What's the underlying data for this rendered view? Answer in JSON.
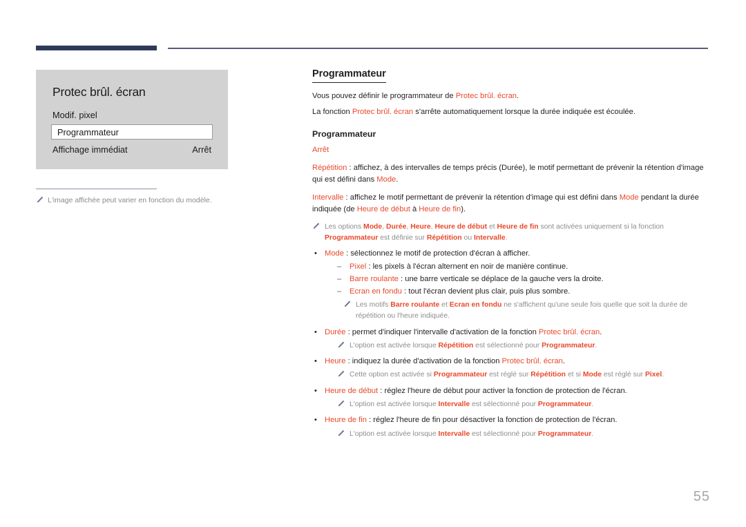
{
  "page": {
    "number": "55"
  },
  "osd": {
    "title": "Protec brûl. écran",
    "rows": [
      {
        "label": "Modif. pixel",
        "value": "",
        "selected": false
      },
      {
        "label": "Programmateur",
        "value": "",
        "selected": true
      },
      {
        "label": "Affichage immédiat",
        "value": "Arrêt",
        "selected": false
      }
    ],
    "footnote": "L'image affichée peut varier en fonction du modèle.",
    "footnote_icon": "pencil-icon"
  },
  "content": {
    "section_title": "Programmateur",
    "intro": [
      {
        "parts": [
          {
            "t": "Vous pouvez définir le programmateur de ",
            "s": "n"
          },
          {
            "t": "Protec brûl. écran",
            "s": "kw"
          },
          {
            "t": ".",
            "s": "n"
          }
        ]
      },
      {
        "parts": [
          {
            "t": "La fonction ",
            "s": "n"
          },
          {
            "t": "Protec brûl. écran",
            "s": "kw"
          },
          {
            "t": " s'arrête automatiquement lorsque la durée indiquée est écoulée.",
            "s": "n"
          }
        ]
      }
    ],
    "sub_title": "Programmateur",
    "options": [
      {
        "parts": [
          {
            "t": "Arrêt",
            "s": "kw"
          }
        ]
      },
      {
        "parts": [
          {
            "t": "Répétition",
            "s": "kw"
          },
          {
            "t": " : affichez, à des intervalles de temps précis (Durée), le motif permettant de prévenir la rétention d'image qui est défini dans ",
            "s": "n"
          },
          {
            "t": "Mode",
            "s": "kw"
          },
          {
            "t": ".",
            "s": "n"
          }
        ]
      },
      {
        "parts": [
          {
            "t": "Intervalle",
            "s": "kw"
          },
          {
            "t": " : affichez le motif permettant de prévenir la rétention d'image qui est défini dans ",
            "s": "n"
          },
          {
            "t": "Mode",
            "s": "kw"
          },
          {
            "t": " pendant la durée indiquée (de ",
            "s": "n"
          },
          {
            "t": "Heure de début",
            "s": "kw"
          },
          {
            "t": " à ",
            "s": "n"
          },
          {
            "t": "Heure de fin",
            "s": "kw"
          },
          {
            "t": ").",
            "s": "n"
          }
        ]
      }
    ],
    "note_after_options": {
      "icon": "pencil-icon",
      "parts": [
        {
          "t": "Les options ",
          "s": "g"
        },
        {
          "t": "Mode",
          "s": "kwb"
        },
        {
          "t": ", ",
          "s": "g"
        },
        {
          "t": "Durée",
          "s": "kwb"
        },
        {
          "t": ", ",
          "s": "g"
        },
        {
          "t": "Heure",
          "s": "kwb"
        },
        {
          "t": ", ",
          "s": "g"
        },
        {
          "t": "Heure de début",
          "s": "kwb"
        },
        {
          "t": " et ",
          "s": "g"
        },
        {
          "t": "Heure de fin",
          "s": "kwb"
        },
        {
          "t": " sont activées uniquement si la fonction ",
          "s": "g"
        },
        {
          "t": "Programmateur",
          "s": "kwb"
        },
        {
          "t": " est définie sur ",
          "s": "g"
        },
        {
          "t": "Répétition",
          "s": "kwb"
        },
        {
          "t": " ou ",
          "s": "g"
        },
        {
          "t": "Intervalle",
          "s": "kwb"
        },
        {
          "t": ".",
          "s": "g"
        }
      ]
    },
    "bullets": [
      {
        "mark": "•",
        "parts": [
          {
            "t": "Mode",
            "s": "kw"
          },
          {
            "t": " : sélectionnez le motif de protection d'écran à afficher.",
            "s": "n"
          }
        ],
        "subitems": [
          {
            "mark": "–",
            "parts": [
              {
                "t": "Pixel",
                "s": "kw"
              },
              {
                "t": " : les pixels à l'écran alternent en noir de manière continue.",
                "s": "n"
              }
            ]
          },
          {
            "mark": "–",
            "parts": [
              {
                "t": "Barre roulante",
                "s": "kw"
              },
              {
                "t": " : une barre verticale se déplace de la gauche vers la droite.",
                "s": "n"
              }
            ]
          },
          {
            "mark": "–",
            "parts": [
              {
                "t": "Ecran en fondu",
                "s": "kw"
              },
              {
                "t": " : tout l'écran devient plus clair, puis plus sombre.",
                "s": "n"
              }
            ]
          }
        ],
        "notes": [
          {
            "icon": "pencil-icon",
            "indent": 2,
            "parts": [
              {
                "t": "Les motifs ",
                "s": "g"
              },
              {
                "t": "Barre roulante",
                "s": "kwb"
              },
              {
                "t": " et ",
                "s": "g"
              },
              {
                "t": "Ecran en fondu",
                "s": "kwb"
              },
              {
                "t": " ne s'affichent qu'une seule fois quelle que soit la durée de répétition ou l'heure indiquée.",
                "s": "g"
              }
            ]
          }
        ]
      },
      {
        "mark": "•",
        "parts": [
          {
            "t": "Durée",
            "s": "kw"
          },
          {
            "t": " : permet d'indiquer l'intervalle d'activation de la fonction ",
            "s": "n"
          },
          {
            "t": "Protec brûl. écran",
            "s": "kw"
          },
          {
            "t": ".",
            "s": "n"
          }
        ],
        "subitems": [],
        "notes": [
          {
            "icon": "pencil-icon",
            "indent": 1,
            "parts": [
              {
                "t": "L'option est activée lorsque ",
                "s": "g"
              },
              {
                "t": "Répétition",
                "s": "kwb"
              },
              {
                "t": " est sélectionné pour ",
                "s": "g"
              },
              {
                "t": "Programmateur",
                "s": "kwb"
              },
              {
                "t": ".",
                "s": "g"
              }
            ]
          }
        ]
      },
      {
        "mark": "•",
        "parts": [
          {
            "t": "Heure",
            "s": "kw"
          },
          {
            "t": " : indiquez la durée d'activation de la fonction ",
            "s": "n"
          },
          {
            "t": "Protec brûl. écran",
            "s": "kw"
          },
          {
            "t": ".",
            "s": "n"
          }
        ],
        "subitems": [],
        "notes": [
          {
            "icon": "pencil-icon",
            "indent": 1,
            "parts": [
              {
                "t": "Cette option est activée si ",
                "s": "g"
              },
              {
                "t": "Programmateur",
                "s": "kwb"
              },
              {
                "t": " est réglé sur ",
                "s": "g"
              },
              {
                "t": "Répétition",
                "s": "kwb"
              },
              {
                "t": " et si ",
                "s": "g"
              },
              {
                "t": "Mode",
                "s": "kwb"
              },
              {
                "t": " est réglé sur ",
                "s": "g"
              },
              {
                "t": "Pixel",
                "s": "kwb"
              },
              {
                "t": ".",
                "s": "g"
              }
            ]
          }
        ]
      },
      {
        "mark": "•",
        "parts": [
          {
            "t": "Heure de début",
            "s": "kw"
          },
          {
            "t": " : réglez l'heure de début pour activer la fonction de protection de l'écran.",
            "s": "n"
          }
        ],
        "subitems": [],
        "notes": [
          {
            "icon": "pencil-icon",
            "indent": 1,
            "parts": [
              {
                "t": "L'option est activée lorsque ",
                "s": "g"
              },
              {
                "t": "Intervalle",
                "s": "kwb"
              },
              {
                "t": " est sélectionné pour ",
                "s": "g"
              },
              {
                "t": "Programmateur",
                "s": "kwb"
              },
              {
                "t": ".",
                "s": "g"
              }
            ]
          }
        ]
      },
      {
        "mark": "•",
        "parts": [
          {
            "t": "Heure de fin",
            "s": "kw"
          },
          {
            "t": " : réglez l'heure de fin pour désactiver la fonction de protection de l'écran.",
            "s": "n"
          }
        ],
        "subitems": [],
        "notes": [
          {
            "icon": "pencil-icon",
            "indent": 1,
            "parts": [
              {
                "t": "L'option est activée lorsque ",
                "s": "g"
              },
              {
                "t": "Intervalle",
                "s": "kwb"
              },
              {
                "t": " est sélectionné pour ",
                "s": "g"
              },
              {
                "t": "Programmateur",
                "s": "kwb"
              },
              {
                "t": ".",
                "s": "g"
              }
            ]
          }
        ]
      }
    ]
  },
  "colors": {
    "keyword": "#e8492b",
    "header_bar": "#2d3a5a",
    "header_rule": "#5a5a78",
    "panel_bg": "#d2d2d2",
    "note_text": "#8c8c8c",
    "page_number": "#a6a6a6"
  }
}
